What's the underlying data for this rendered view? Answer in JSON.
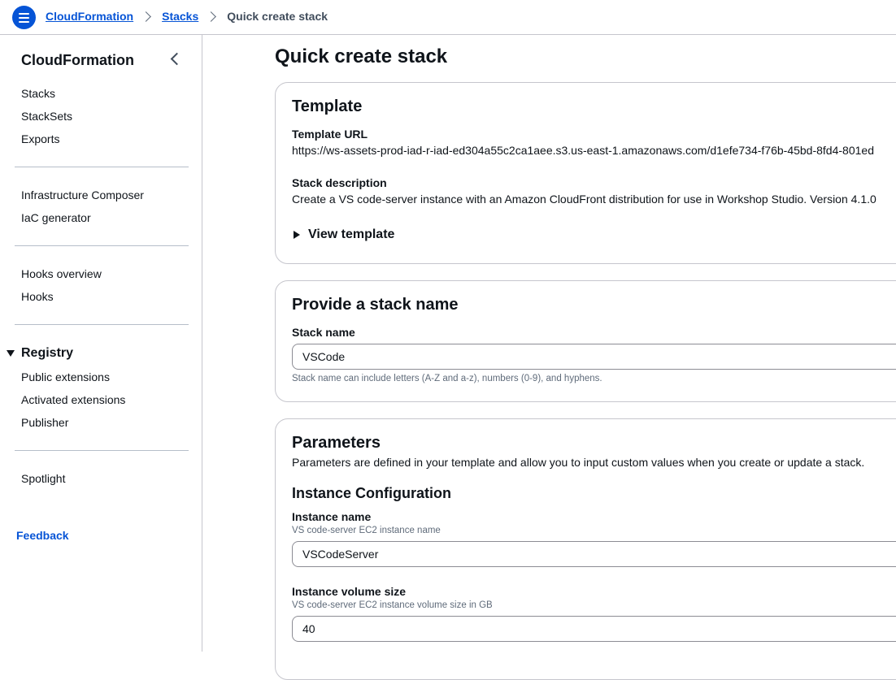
{
  "breadcrumbs": {
    "root": "CloudFormation",
    "level2": "Stacks",
    "current": "Quick create stack"
  },
  "sidebar": {
    "title": "CloudFormation",
    "group1": [
      "Stacks",
      "StackSets",
      "Exports"
    ],
    "group2": [
      "Infrastructure Composer",
      "IaC generator"
    ],
    "group3": [
      "Hooks overview",
      "Hooks"
    ],
    "registry": {
      "heading": "Registry",
      "items": [
        "Public extensions",
        "Activated extensions",
        "Publisher"
      ]
    },
    "group4": [
      "Spotlight"
    ],
    "feedback": "Feedback"
  },
  "page": {
    "title": "Quick create stack"
  },
  "template_panel": {
    "title": "Template",
    "url_label": "Template URL",
    "url_value": "https://ws-assets-prod-iad-r-iad-ed304a55c2ca1aee.s3.us-east-1.amazonaws.com/d1efe734-f76b-45bd-8fd4-801ed",
    "desc_label": "Stack description",
    "desc_value": "Create a VS code-server instance with an Amazon CloudFront distribution for use in Workshop Studio. Version 4.1.0",
    "view_template": "View template"
  },
  "stack_name_panel": {
    "title": "Provide a stack name",
    "label": "Stack name",
    "value": "VSCode",
    "hint": "Stack name can include letters (A-Z and a-z), numbers (0-9), and hyphens."
  },
  "parameters_panel": {
    "title": "Parameters",
    "description": "Parameters are defined in your template and allow you to input custom values when you create or update a stack.",
    "section_title": "Instance Configuration",
    "instance_name": {
      "label": "Instance name",
      "hint": "VS code-server EC2 instance name",
      "value": "VSCodeServer"
    },
    "volume_size": {
      "label": "Instance volume size",
      "hint": "VS code-server EC2 instance volume size in GB",
      "value": "40"
    }
  }
}
